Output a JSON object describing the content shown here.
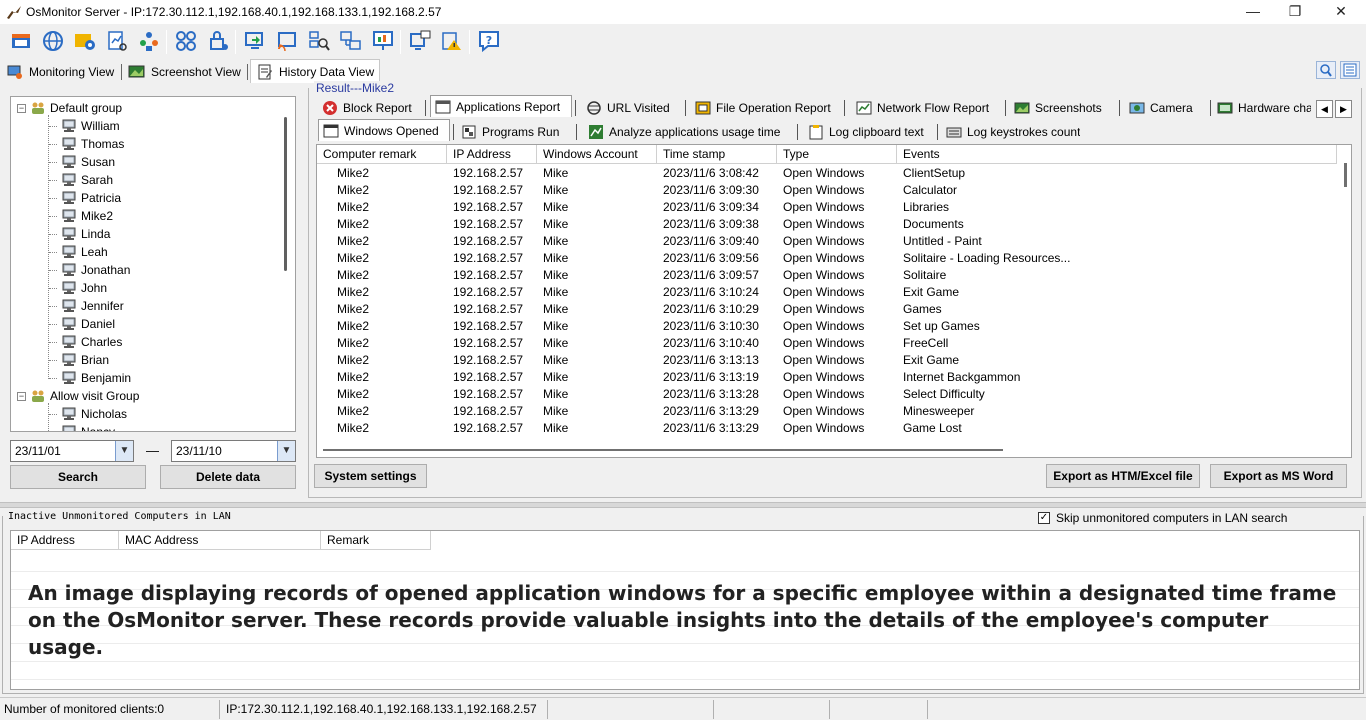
{
  "window": {
    "title": "OsMonitor Server -  IP:172.30.112.1,192.168.40.1,192.168.133.1,192.168.2.57",
    "minimize": "—",
    "maximize": "❐",
    "close": "✕"
  },
  "view_tabs": [
    {
      "label": "Monitoring View",
      "icon": "monitoring-view-icon"
    },
    {
      "label": "Screenshot View",
      "icon": "screenshot-view-icon"
    },
    {
      "label": "History Data View",
      "icon": "history-data-icon"
    }
  ],
  "tree": {
    "groups": [
      {
        "label": "Default group",
        "expander": "−",
        "items": [
          "William",
          "Thomas",
          "Susan",
          "Sarah",
          "Patricia",
          "Mike2",
          "Linda",
          "Leah",
          "Jonathan",
          "John",
          "Jennifer",
          "Daniel",
          "Charles",
          "Brian",
          "Benjamin"
        ]
      },
      {
        "label": "Allow visit Group",
        "expander": "−",
        "items": [
          "Nicholas",
          "Nancy"
        ]
      }
    ]
  },
  "date_from": "23/11/01",
  "date_dash": "—",
  "date_to": "23/11/10",
  "search_label": "Search",
  "delete_label": "Delete data",
  "result_title": "Result---Mike2",
  "report_tabs_row1": [
    {
      "label": "Block Report",
      "icon": "block-icon"
    },
    {
      "label": "Applications Report",
      "icon": "applications-icon"
    },
    {
      "label": "URL Visited",
      "icon": "url-icon"
    },
    {
      "label": "File Operation Report",
      "icon": "file-operation-icon"
    },
    {
      "label": "Network Flow Report",
      "icon": "network-flow-icon"
    },
    {
      "label": "Screenshots",
      "icon": "screenshots-icon"
    },
    {
      "label": "Camera",
      "icon": "camera-icon"
    },
    {
      "label": "Hardware cha",
      "icon": "hardware-icon"
    }
  ],
  "report_tabs_row2": [
    {
      "label": "Windows Opened",
      "icon": "windows-opened-icon"
    },
    {
      "label": "Programs Run",
      "icon": "programs-run-icon"
    },
    {
      "label": "Analyze applications usage time",
      "icon": "analyze-icon"
    },
    {
      "label": "Log clipboard text",
      "icon": "clipboard-icon"
    },
    {
      "label": "Log keystrokes count",
      "icon": "keystrokes-icon"
    }
  ],
  "tab_scroll": {
    "left": "◀",
    "right": "▶"
  },
  "table": {
    "columns": [
      "Computer remark",
      "IP Address",
      "Windows Account",
      "Time stamp",
      "Type",
      "Events"
    ],
    "rows": [
      [
        "Mike2",
        "192.168.2.57",
        "Mike",
        "2023/11/6 3:08:42",
        "Open Windows",
        "ClientSetup"
      ],
      [
        "Mike2",
        "192.168.2.57",
        "Mike",
        "2023/11/6 3:09:30",
        "Open Windows",
        "Calculator"
      ],
      [
        "Mike2",
        "192.168.2.57",
        "Mike",
        "2023/11/6 3:09:34",
        "Open Windows",
        "Libraries"
      ],
      [
        "Mike2",
        "192.168.2.57",
        "Mike",
        "2023/11/6 3:09:38",
        "Open Windows",
        "Documents"
      ],
      [
        "Mike2",
        "192.168.2.57",
        "Mike",
        "2023/11/6 3:09:40",
        "Open Windows",
        "Untitled - Paint"
      ],
      [
        "Mike2",
        "192.168.2.57",
        "Mike",
        "2023/11/6 3:09:56",
        "Open Windows",
        "Solitaire - Loading Resources..."
      ],
      [
        "Mike2",
        "192.168.2.57",
        "Mike",
        "2023/11/6 3:09:57",
        "Open Windows",
        "Solitaire"
      ],
      [
        "Mike2",
        "192.168.2.57",
        "Mike",
        "2023/11/6 3:10:24",
        "Open Windows",
        "Exit Game"
      ],
      [
        "Mike2",
        "192.168.2.57",
        "Mike",
        "2023/11/6 3:10:29",
        "Open Windows",
        "Games"
      ],
      [
        "Mike2",
        "192.168.2.57",
        "Mike",
        "2023/11/6 3:10:30",
        "Open Windows",
        "Set up Games"
      ],
      [
        "Mike2",
        "192.168.2.57",
        "Mike",
        "2023/11/6 3:10:40",
        "Open Windows",
        "FreeCell"
      ],
      [
        "Mike2",
        "192.168.2.57",
        "Mike",
        "2023/11/6 3:13:13",
        "Open Windows",
        "Exit Game"
      ],
      [
        "Mike2",
        "192.168.2.57",
        "Mike",
        "2023/11/6 3:13:19",
        "Open Windows",
        "Internet Backgammon"
      ],
      [
        "Mike2",
        "192.168.2.57",
        "Mike",
        "2023/11/6 3:13:28",
        "Open Windows",
        "Select Difficulty"
      ],
      [
        "Mike2",
        "192.168.2.57",
        "Mike",
        "2023/11/6 3:13:29",
        "Open Windows",
        "Minesweeper"
      ],
      [
        "Mike2",
        "192.168.2.57",
        "Mike",
        "2023/11/6 3:13:29",
        "Open Windows",
        "Game Lost"
      ]
    ]
  },
  "system_settings_label": "System settings",
  "export_htm_label": "Export as HTM/Excel file",
  "export_word_label": "Export as MS Word",
  "lan": {
    "title": "Inactive Unmonitored Computers in LAN",
    "skip_label": "Skip unmonitored computers in LAN search",
    "skip_checked": "✓",
    "columns": [
      "IP Address",
      "MAC Address",
      "Remark"
    ]
  },
  "caption": "An image displaying records of opened application windows for a specific employee within a designated time frame on the OsMonitor server. These records provide valuable insights into the details of the employee's computer usage.",
  "status": {
    "monitored": "Number of monitored clients:0",
    "ip": "IP:172.30.112.1,192.168.40.1,192.168.133.1,192.168.2.57"
  },
  "colors": {
    "legend_blue": "#2a3aa0",
    "accent": "#2b6cc4"
  }
}
